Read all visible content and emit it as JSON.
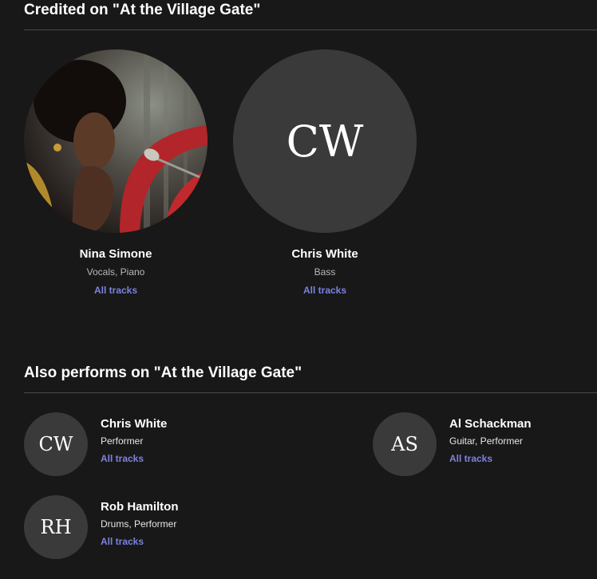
{
  "credited": {
    "title": "Credited on \"At the Village Gate\"",
    "artists": [
      {
        "name": "Nina Simone",
        "roles": "Vocals, Piano",
        "link_label": "All tracks",
        "avatar": "photo"
      },
      {
        "name": "Chris White",
        "roles": "Bass",
        "link_label": "All tracks",
        "initials": "CW"
      }
    ]
  },
  "performers": {
    "title": "Also performs on \"At the Village Gate\"",
    "items": [
      {
        "initials": "CW",
        "name": "Chris White",
        "roles": "Performer",
        "link_label": "All tracks"
      },
      {
        "initials": "AS",
        "name": "Al Schackman",
        "roles": "Guitar, Performer",
        "link_label": "All tracks"
      },
      {
        "initials": "RH",
        "name": "Rob Hamilton",
        "roles": "Drums, Performer",
        "link_label": "All tracks"
      }
    ]
  },
  "colors": {
    "background": "#181818",
    "avatar_bg": "#3a3a3b",
    "link": "#7b82e0",
    "divider": "#4a4a4a"
  }
}
